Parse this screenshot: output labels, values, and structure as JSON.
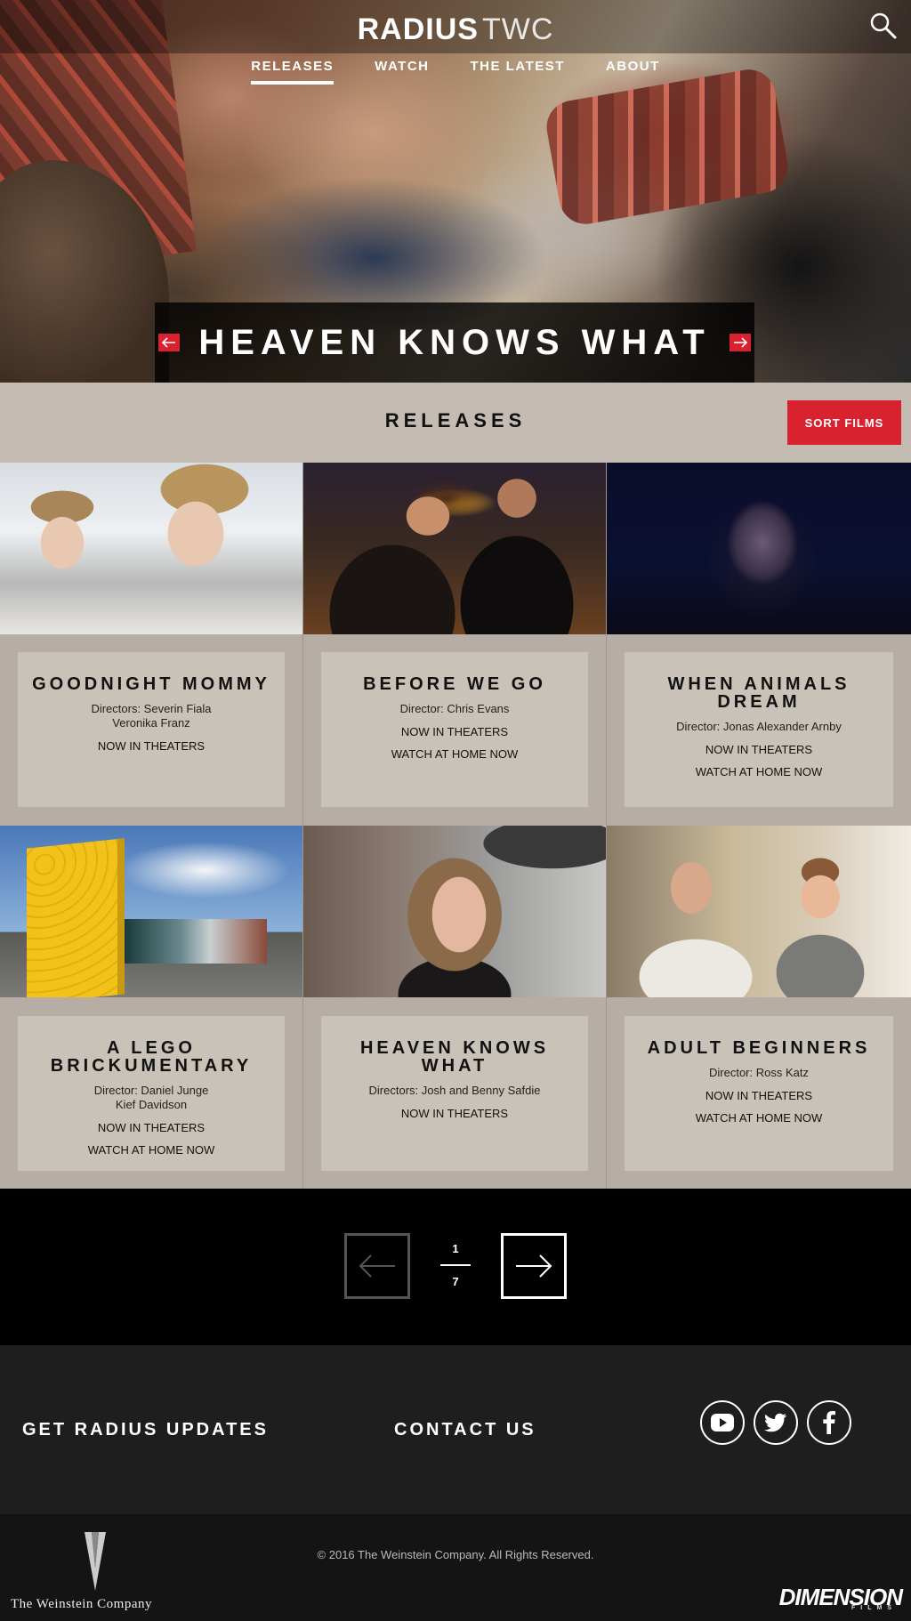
{
  "site": {
    "logo_primary": "RADIUS",
    "logo_secondary": "TWC"
  },
  "nav": {
    "items": [
      {
        "label": "RELEASES",
        "active": true
      },
      {
        "label": "WATCH",
        "active": false
      },
      {
        "label": "THE LATEST",
        "active": false
      },
      {
        "label": "ABOUT",
        "active": false
      }
    ]
  },
  "hero": {
    "title": "HEAVEN KNOWS WHAT"
  },
  "releases": {
    "heading": "RELEASES",
    "sort_label": "SORT FILMS"
  },
  "films": [
    {
      "title": "GOODNIGHT MOMMY",
      "director": "Directors: Severin Fiala\nVeronika Franz",
      "links": [
        "NOW IN THEATERS"
      ]
    },
    {
      "title": "BEFORE WE GO",
      "director": "Director: Chris Evans",
      "links": [
        "NOW IN THEATERS",
        "WATCH AT HOME NOW"
      ]
    },
    {
      "title": "WHEN ANIMALS DREAM",
      "director": "Director: Jonas Alexander Arnby",
      "links": [
        "NOW IN THEATERS",
        "WATCH AT HOME NOW"
      ]
    },
    {
      "title": "A LEGO BRICKUMENTARY",
      "director": "Director: Daniel Junge\nKief Davidson",
      "links": [
        "NOW IN THEATERS",
        "WATCH AT HOME NOW"
      ]
    },
    {
      "title": "HEAVEN KNOWS WHAT",
      "director": "Directors: Josh and Benny Safdie",
      "links": [
        "NOW IN THEATERS"
      ]
    },
    {
      "title": "ADULT BEGINNERS",
      "director": "Director: Ross Katz",
      "links": [
        "NOW IN THEATERS",
        "WATCH AT HOME NOW"
      ]
    }
  ],
  "pagination": {
    "current": "1",
    "total": "7"
  },
  "footer": {
    "updates_label": "GET RADIUS UPDATES",
    "contact_label": "CONTACT US",
    "social": [
      "youtube-icon",
      "twitter-icon",
      "facebook-icon"
    ],
    "copyright": "© 2016 The Weinstein Company. All Rights Reserved.",
    "twc_logo_text": "The Weinstein Company",
    "dimension_logo_text": "DIMENSION",
    "dimension_logo_sub": "FILMS"
  },
  "colors": {
    "accent_red": "#d9222f",
    "panel_tan": "#c4bcb2",
    "footer_dark": "#1e1e1e"
  }
}
